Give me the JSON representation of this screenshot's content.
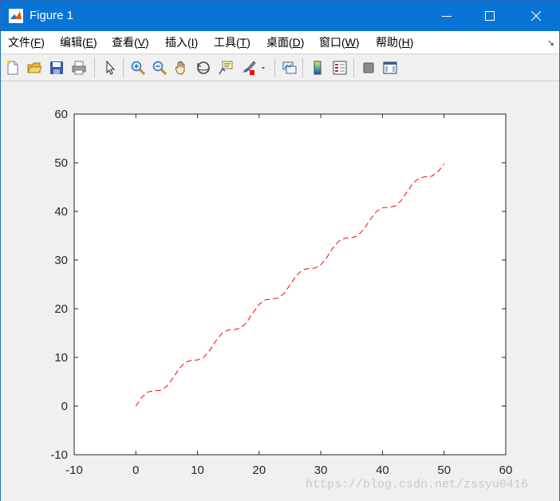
{
  "window": {
    "title": "Figure 1"
  },
  "menu": {
    "items": [
      {
        "label": "文件(",
        "accel": "F",
        "tail": ")"
      },
      {
        "label": "编辑(",
        "accel": "E",
        "tail": ")"
      },
      {
        "label": "查看(",
        "accel": "V",
        "tail": ")"
      },
      {
        "label": "插入(",
        "accel": "I",
        "tail": ")"
      },
      {
        "label": "工具(",
        "accel": "T",
        "tail": ")"
      },
      {
        "label": "桌面(",
        "accel": "D",
        "tail": ")"
      },
      {
        "label": "窗口(",
        "accel": "W",
        "tail": ")"
      },
      {
        "label": "帮助(",
        "accel": "H",
        "tail": ")"
      }
    ]
  },
  "toolbar": {
    "icons": [
      "new-figure-icon",
      "open-file-icon",
      "save-icon",
      "print-icon",
      "pointer-icon",
      "zoom-in-icon",
      "zoom-out-icon",
      "pan-hand-icon",
      "rotate-3d-icon",
      "data-cursor-icon",
      "brush-icon",
      "link-plot-icon",
      "colorbar-icon",
      "legend-icon",
      "hide-plot-tools-icon",
      "show-plot-tools-icon"
    ]
  },
  "chart_data": {
    "type": "line",
    "line_style": "dashed",
    "line_color": "#ff0000",
    "xlim": [
      -10,
      60
    ],
    "ylim": [
      -10,
      60
    ],
    "xticks": [
      -10,
      0,
      10,
      20,
      30,
      40,
      50,
      60
    ],
    "yticks": [
      -10,
      0,
      10,
      20,
      30,
      40,
      50,
      60
    ],
    "grid": false,
    "series": [
      {
        "x": [
          0,
          1,
          2,
          3,
          4,
          5,
          6,
          7,
          8,
          9,
          10,
          11,
          12,
          13,
          14,
          15,
          16,
          17,
          18,
          19,
          20,
          21,
          22,
          23,
          24,
          25,
          26,
          27,
          28,
          29,
          30,
          31,
          32,
          33,
          34,
          35,
          36,
          37,
          38,
          39,
          40,
          41,
          42,
          43,
          44,
          45,
          46,
          47,
          48,
          49,
          50
        ],
        "y": [
          0.0,
          1.84,
          2.91,
          3.14,
          3.24,
          4.04,
          5.72,
          7.66,
          8.99,
          9.41,
          9.46,
          10.0,
          11.46,
          13.42,
          14.99,
          15.65,
          15.71,
          16.04,
          17.25,
          19.15,
          20.91,
          21.84,
          21.99,
          22.15,
          23.09,
          24.87,
          26.76,
          27.96,
          28.27,
          28.34,
          29.01,
          30.6,
          32.55,
          33.99,
          34.53,
          34.57,
          35.01,
          36.36,
          38.3,
          39.96,
          40.75,
          40.84,
          41.08,
          42.18,
          44.02,
          45.85,
          46.9,
          47.12,
          47.24,
          48.14,
          49.74
        ]
      }
    ]
  },
  "watermark": {
    "text": "https://blog.csdn.net/zssyu0416"
  },
  "colors": {
    "titlebar": "#0a74d6",
    "plot_background": "#ffffff",
    "figure_background": "#f0f0f0",
    "line": "#ff0000"
  }
}
